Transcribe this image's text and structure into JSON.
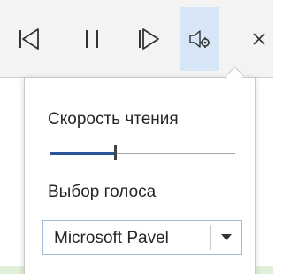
{
  "toolbar": {
    "buttons": [
      {
        "name": "previous",
        "icon": "skip-back-icon"
      },
      {
        "name": "pause",
        "icon": "pause-icon"
      },
      {
        "name": "next",
        "icon": "skip-forward-icon"
      },
      {
        "name": "voice-settings",
        "icon": "speaker-settings-icon",
        "selected": true
      },
      {
        "name": "close",
        "icon": "close-icon"
      }
    ]
  },
  "panel": {
    "speed_label": "Скорость чтения",
    "speed_value": 0.35,
    "voice_label": "Выбор голоса",
    "voice_selected": "Microsoft Pavel"
  },
  "colors": {
    "accent": "#2b579a",
    "toolbar_bg": "#f3f3f3",
    "selected_bg": "#d6e6f6"
  }
}
